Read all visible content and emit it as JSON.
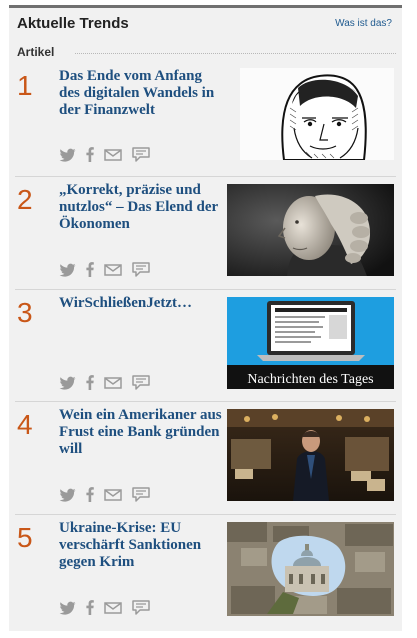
{
  "header": {
    "title": "Aktuelle Trends",
    "help_link": "Was ist das?"
  },
  "section": {
    "label": "Artikel"
  },
  "articles": [
    {
      "rank": "1",
      "title": "Das Ende vom Anfang des digitalen Wandels in der Finanzwelt",
      "thumbnail": "engraved-portrait-of-man"
    },
    {
      "rank": "2",
      "title": "„Korrekt, präzise und nutzlos“ – Das Elend der Ökonomen",
      "thumbnail": "portrait-of-man-with-powdered-wig"
    },
    {
      "rank": "3",
      "title": "WirSchließenJetzt…",
      "thumbnail": "laptop-newspaper",
      "thumbnail_caption": "Nachrichten des Tages"
    },
    {
      "rank": "4",
      "title": "Wein ein Amerikaner aus Frust eine Bank gründen will",
      "thumbnail": "man-in-restaurant"
    },
    {
      "rank": "5",
      "title": "Ukraine-Krise: EU verschärft Sanktionen gegen Krim",
      "thumbnail": "cathedral-through-stone-wall"
    }
  ],
  "share_icons": [
    "twitter-icon",
    "facebook-icon",
    "email-icon",
    "comment-icon"
  ],
  "colors": {
    "rank": "#c95718",
    "title": "#1e4f7f",
    "panel_bg": "#f1f1f1",
    "icons": "#9a9a9a",
    "laptop_tile": "#1e9ee0"
  }
}
